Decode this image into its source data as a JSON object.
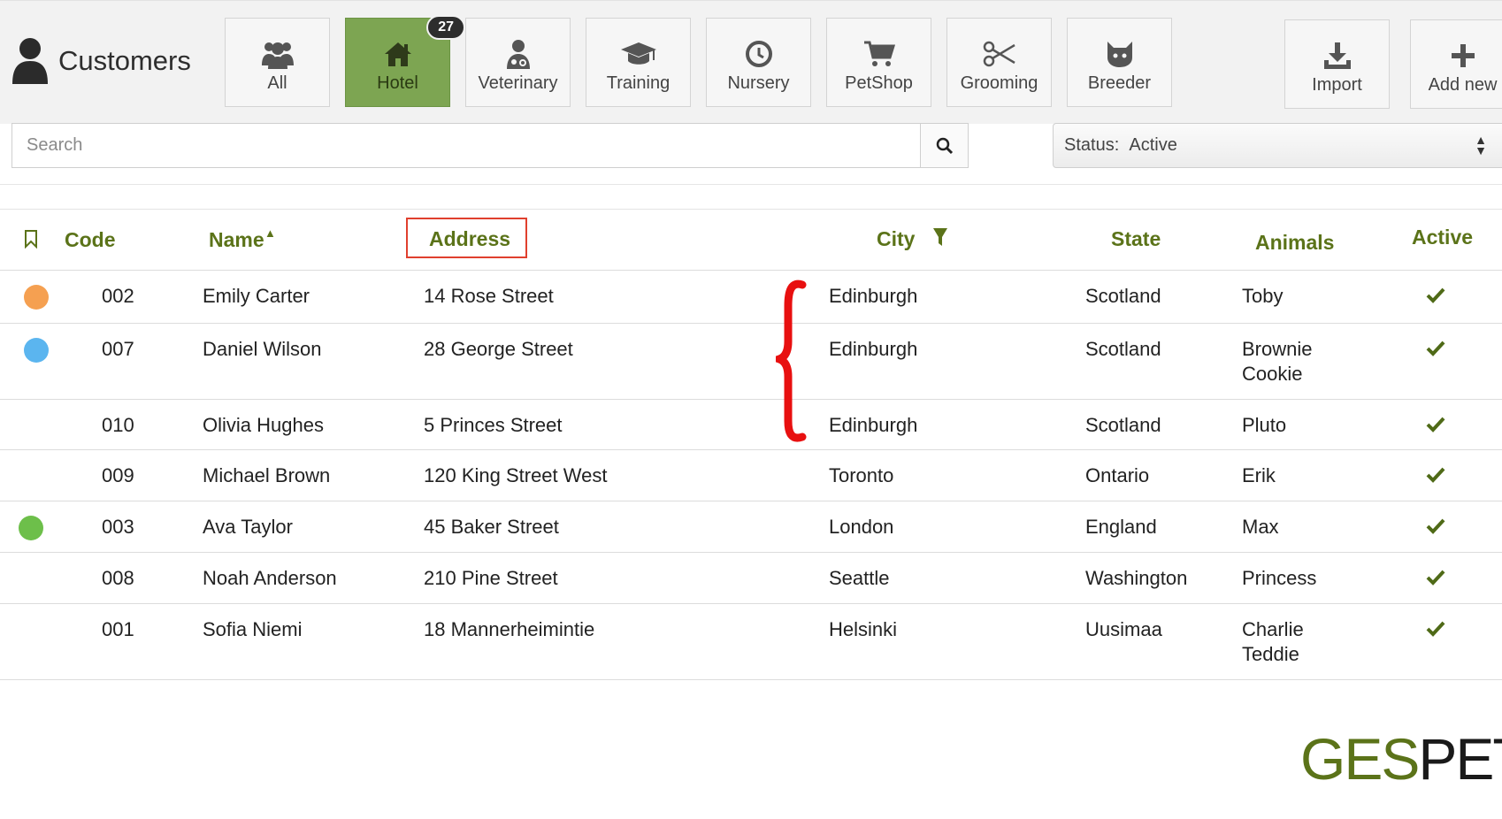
{
  "header": {
    "title": "Customers"
  },
  "categories": [
    {
      "label": "All",
      "icon": "users-icon",
      "active": false
    },
    {
      "label": "Hotel",
      "icon": "home-icon",
      "active": true,
      "badge": "27"
    },
    {
      "label": "Veterinary",
      "icon": "doctor-icon",
      "active": false
    },
    {
      "label": "Training",
      "icon": "graduation-cap-icon",
      "active": false
    },
    {
      "label": "Nursery",
      "icon": "clock-icon",
      "active": false
    },
    {
      "label": "PetShop",
      "icon": "cart-icon",
      "active": false
    },
    {
      "label": "Grooming",
      "icon": "scissors-icon",
      "active": false
    },
    {
      "label": "Breeder",
      "icon": "cat-icon",
      "active": false
    }
  ],
  "actions": {
    "import_label": "Import",
    "add_label": "Add new"
  },
  "search": {
    "placeholder": "Search",
    "value": ""
  },
  "status_filter": {
    "label": "Status:",
    "value": "Active"
  },
  "table": {
    "columns": {
      "code": "Code",
      "name": "Name",
      "address": "Address",
      "city": "City",
      "state": "State",
      "animals": "Animals",
      "active": "Active"
    },
    "rows": [
      {
        "color": "#f5a051",
        "code": "002",
        "name": "Emily Carter",
        "address": "14 Rose Street",
        "city": "Edinburgh",
        "state": "Scotland",
        "animals": [
          "Toby"
        ],
        "active": true
      },
      {
        "color": "#5bb5ef",
        "code": "007",
        "name": "Daniel Wilson",
        "address": "28 George Street",
        "city": "Edinburgh",
        "state": "Scotland",
        "animals": [
          "Brownie",
          "Cookie"
        ],
        "active": true
      },
      {
        "color": "",
        "code": "010",
        "name": "Olivia Hughes",
        "address": "5 Princes Street",
        "city": "Edinburgh",
        "state": "Scotland",
        "animals": [
          "Pluto"
        ],
        "active": true
      },
      {
        "color": "",
        "code": "009",
        "name": "Michael Brown",
        "address": "120 King Street West",
        "city": "Toronto",
        "state": "Ontario",
        "animals": [
          "Erik"
        ],
        "active": true
      },
      {
        "color": "#6dbf4a",
        "code": "003",
        "name": "Ava Taylor",
        "address": "45 Baker Street",
        "city": "London",
        "state": "England",
        "animals": [
          "Max"
        ],
        "active": true
      },
      {
        "color": "",
        "code": "008",
        "name": "Noah Anderson",
        "address": "210 Pine Street",
        "city": "Seattle",
        "state": "Washington",
        "animals": [
          "Princess"
        ],
        "active": true
      },
      {
        "color": "",
        "code": "001",
        "name": "Sofia Niemi",
        "address": "18 Mannerheimintie",
        "city": "Helsinki",
        "state": "Uusimaa",
        "animals": [
          "Charlie",
          "Teddie"
        ],
        "active": true
      }
    ]
  },
  "logo": {
    "part1": "GES",
    "part2": "PET"
  },
  "colors": {
    "accent": "#5b7319",
    "active_tab": "#7da552",
    "annotation": "#e0402e",
    "brace": "#e81010"
  }
}
